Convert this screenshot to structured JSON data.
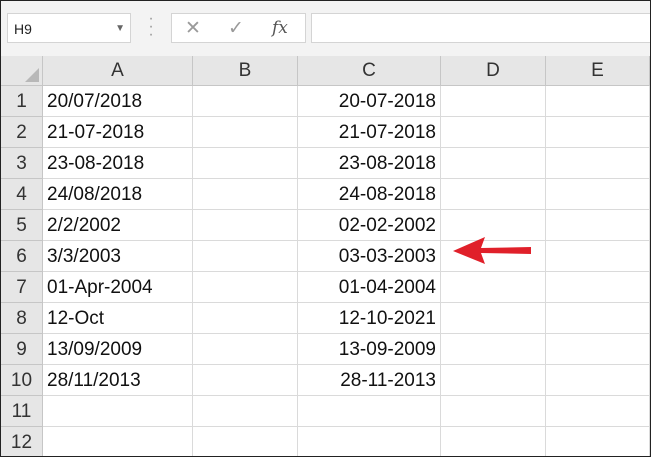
{
  "formula_bar": {
    "name_box": "H9",
    "name_box_dropdown_icon": "chevron-down-icon",
    "cancel_icon": "close-icon",
    "enter_icon": "checkmark-icon",
    "fx_label": "fx",
    "formula_value": ""
  },
  "columns": [
    "A",
    "B",
    "C",
    "D",
    "E"
  ],
  "rows": [
    {
      "num": "1",
      "A": "20/07/2018",
      "B": "",
      "C": "20-07-2018",
      "D": "",
      "E": ""
    },
    {
      "num": "2",
      "A": "21-07-2018",
      "B": "",
      "C": "21-07-2018",
      "D": "",
      "E": ""
    },
    {
      "num": "3",
      "A": "23-08-2018",
      "B": "",
      "C": "23-08-2018",
      "D": "",
      "E": ""
    },
    {
      "num": "4",
      "A": "24/08/2018",
      "B": "",
      "C": "24-08-2018",
      "D": "",
      "E": ""
    },
    {
      "num": "5",
      "A": "2/2/2002",
      "B": "",
      "C": "02-02-2002",
      "D": "",
      "E": ""
    },
    {
      "num": "6",
      "A": "3/3/2003",
      "B": "",
      "C": "03-03-2003",
      "D": "",
      "E": ""
    },
    {
      "num": "7",
      "A": "01-Apr-2004",
      "B": "",
      "C": "01-04-2004",
      "D": "",
      "E": ""
    },
    {
      "num": "8",
      "A": "12-Oct",
      "B": "",
      "C": "12-10-2021",
      "D": "",
      "E": ""
    },
    {
      "num": "9",
      "A": "13/09/2009",
      "B": "",
      "C": "13-09-2009",
      "D": "",
      "E": ""
    },
    {
      "num": "10",
      "A": "28/11/2013",
      "B": "",
      "C": "28-11-2013",
      "D": "",
      "E": ""
    },
    {
      "num": "11",
      "A": "",
      "B": "",
      "C": "",
      "D": "",
      "E": ""
    },
    {
      "num": "12",
      "A": "",
      "B": "",
      "C": "",
      "D": "",
      "E": ""
    }
  ],
  "annotation": {
    "icon": "arrow-left-icon",
    "color": "#e0202a",
    "points_to_row": "6"
  },
  "colors": {
    "header_bg": "#e6e6e6",
    "gridline": "#dadada",
    "toolbar_bg": "#f3f3f3"
  }
}
